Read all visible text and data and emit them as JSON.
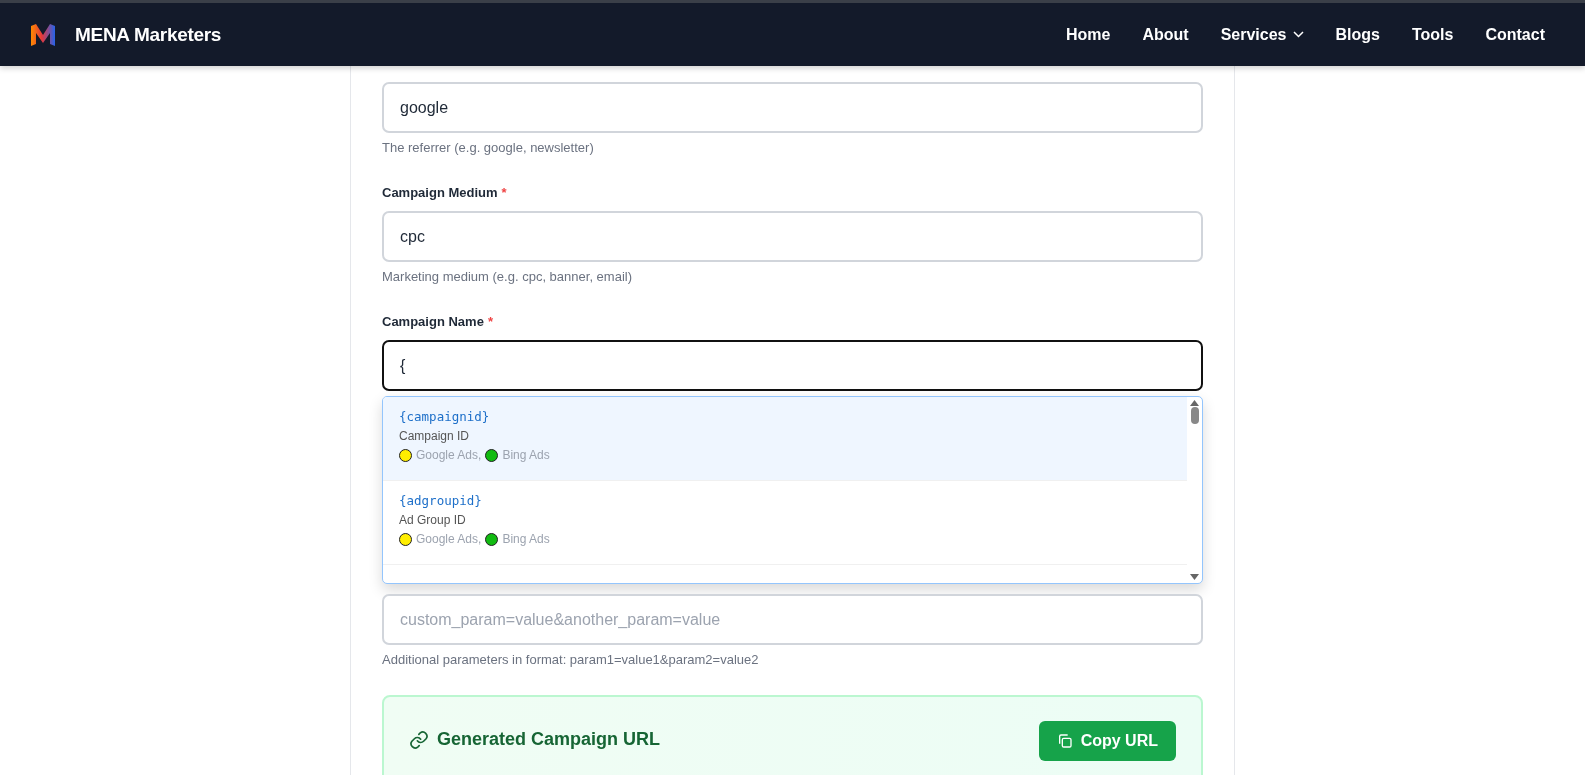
{
  "header": {
    "brand": "MENA Marketers",
    "nav": [
      {
        "label": "Home",
        "has_menu": false
      },
      {
        "label": "About",
        "has_menu": false
      },
      {
        "label": "Services",
        "has_menu": true
      },
      {
        "label": "Blogs",
        "has_menu": false
      },
      {
        "label": "Tools",
        "has_menu": false
      },
      {
        "label": "Contact",
        "has_menu": false
      }
    ]
  },
  "fields": [
    {
      "value": "google",
      "hint": "The referrer (e.g. google, newsletter)",
      "focused": false
    },
    {
      "label": "Campaign Medium",
      "required_mark": "*",
      "value": "cpc",
      "hint": "Marketing medium (e.g. cpc, banner, email)",
      "focused": false
    },
    {
      "label": "Campaign Name",
      "required_mark": "*",
      "value": "{",
      "focused": true
    }
  ],
  "suggestions": [
    {
      "token": "{campaignid}",
      "description": "Campaign ID",
      "selected": true,
      "sources": [
        {
          "name": "Google Ads,",
          "color": "#ffee00"
        },
        {
          "name": "Bing Ads",
          "color": "#11bb11"
        }
      ]
    },
    {
      "token": "{adgroupid}",
      "description": "Ad Group ID",
      "selected": false,
      "sources": [
        {
          "name": "Google Ads,",
          "color": "#ffee00"
        },
        {
          "name": "Bing Ads",
          "color": "#11bb11"
        }
      ]
    }
  ],
  "custom_params": {
    "placeholder": "custom_param=value&another_param=value",
    "hint": "Additional parameters in format: param1=value1&param2=value2"
  },
  "result": {
    "title": "Generated Campaign URL",
    "copy_button": "Copy URL"
  }
}
